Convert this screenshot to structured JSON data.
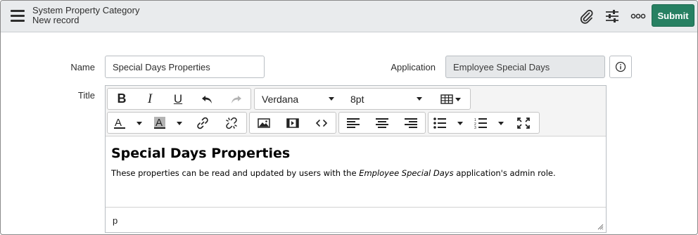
{
  "header": {
    "title": "System Property Category",
    "subtitle": "New record",
    "submit_label": "Submit"
  },
  "form": {
    "name_label": "Name",
    "name_value": "Special Days Properties",
    "application_label": "Application",
    "application_value": "Employee Special Days",
    "title_label": "Title"
  },
  "editor": {
    "font_family": "Verdana",
    "font_size": "8pt",
    "heading": "Special Days Properties",
    "body_before": "These properties can be read and updated by users with the ",
    "body_italic": "Employee Special Days",
    "body_after": " application's admin role.",
    "path": "p"
  },
  "colors": {
    "accent": "#278062",
    "header_bg": "#e9ebed"
  }
}
